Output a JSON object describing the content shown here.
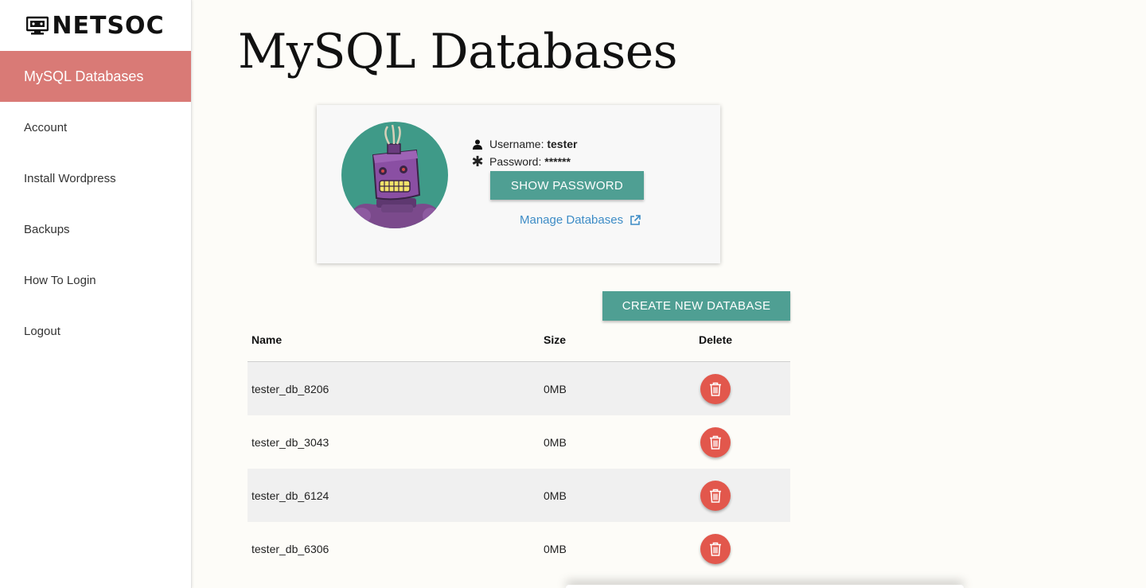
{
  "brand": {
    "name": "NETSOC"
  },
  "sidebar": {
    "items": [
      {
        "label": "MySQL Databases",
        "active": true
      },
      {
        "label": "Account"
      },
      {
        "label": "Install Wordpress"
      },
      {
        "label": "Backups"
      },
      {
        "label": "How To Login"
      },
      {
        "label": "Logout"
      }
    ]
  },
  "page": {
    "title": "MySQL Databases"
  },
  "credentials": {
    "username_label": "Username:",
    "username": "tester",
    "password_label": "Password:",
    "password": "******",
    "show_password_label": "SHOW PASSWORD",
    "manage_link": "Manage Databases"
  },
  "create_button": "CREATE NEW DATABASE",
  "table": {
    "headers": {
      "name": "Name",
      "size": "Size",
      "delete": "Delete"
    },
    "rows": [
      {
        "name": "tester_db_8206",
        "size": "0MB"
      },
      {
        "name": "tester_db_3043",
        "size": "0MB"
      },
      {
        "name": "tester_db_6124",
        "size": "0MB"
      },
      {
        "name": "tester_db_6306",
        "size": "0MB"
      }
    ]
  },
  "colors": {
    "active_nav": "#d97a76",
    "button": "#4f9f93",
    "delete": "#e2574c",
    "link": "#3d8cc6",
    "avatar_bg": "#3f9a88"
  },
  "icons": [
    "monitor-icon",
    "user-icon",
    "asterisk-icon",
    "external-link-icon",
    "trash-icon",
    "robot-avatar"
  ]
}
